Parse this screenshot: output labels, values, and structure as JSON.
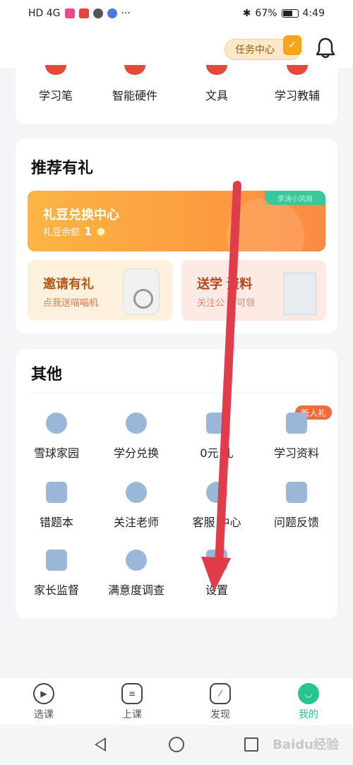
{
  "status_bar": {
    "signal_label": "HD 4G",
    "battery": "67%",
    "time": "4:49"
  },
  "header": {
    "task_center": "任务中心"
  },
  "categories": [
    {
      "label": "学习笔"
    },
    {
      "label": "智能硬件"
    },
    {
      "label": "文具"
    },
    {
      "label": "学习教辅"
    }
  ],
  "recommend": {
    "title": "推荐有礼",
    "exchange": {
      "title": "礼豆兑换中心",
      "balance_label": "礼豆余额",
      "balance_value": "1",
      "tag": "李涛小风扇"
    },
    "invite": {
      "title": "邀请有礼",
      "sub": "点我送喵喵机"
    },
    "study": {
      "title": "送学 资料",
      "sub": "关注公 号可领"
    }
  },
  "other": {
    "title": "其他",
    "new_badge": "新人礼",
    "items": [
      {
        "label": "雪球家园",
        "icon": "snowball-icon"
      },
      {
        "label": "学分兑换",
        "icon": "star-badge-icon"
      },
      {
        "label": "0元 礼",
        "icon": "gift-icon"
      },
      {
        "label": "学习资料",
        "icon": "book-icon"
      },
      {
        "label": "错题本",
        "icon": "notebook-icon"
      },
      {
        "label": "关注老师",
        "icon": "user-icon"
      },
      {
        "label": "客服 中心",
        "icon": "headset-icon"
      },
      {
        "label": "问题反馈",
        "icon": "message-icon"
      },
      {
        "label": "家长监督",
        "icon": "shield-icon"
      },
      {
        "label": "满意度调查",
        "icon": "flower-icon"
      },
      {
        "label": "设置",
        "icon": "settings-icon"
      }
    ]
  },
  "tabs": [
    {
      "label": "选课",
      "icon": "play-icon"
    },
    {
      "label": "上课",
      "icon": "chat-icon"
    },
    {
      "label": "发现",
      "icon": "compass-icon"
    },
    {
      "label": "我的",
      "icon": "smile-icon"
    }
  ],
  "watermark": "Baidu经验",
  "colors": {
    "accent_green": "#28c48f",
    "annotation_arrow": "#e03c4a",
    "exchange_orange": "#fca040"
  }
}
